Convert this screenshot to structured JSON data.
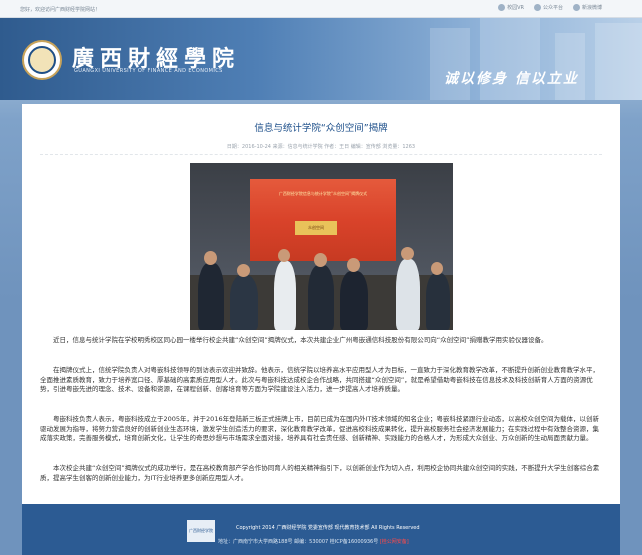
{
  "topbar": {
    "welcome": "您好，欢迎访问广西财经学院网站！",
    "links": [
      {
        "label": "校园VR",
        "icon": "vr-icon"
      },
      {
        "label": "公众平台",
        "icon": "wechat-icon"
      },
      {
        "label": "新浪微博",
        "icon": "weibo-icon"
      }
    ]
  },
  "header": {
    "school_name": "廣西財經學院",
    "school_name_en": "GUANGXI UNIVERSITY OF FINANCE AND ECONOMICS",
    "motto": "诚以修身  信以立业"
  },
  "article": {
    "title": "信息与统计学院“众创空间”揭牌",
    "meta": "日期：2016-10-24    来源：信息与统计学院    作者：王日    编辑：宣传部    浏览量：1263",
    "photo": {
      "banner_text": "广西财经学院信息与统计学院“众创空间”揭牌仪式",
      "plaque_text": "众创空间"
    },
    "paragraphs": [
      "近日，信息与统计学院在学校明秀校区同心园一楼举行校企共建“众创空间”揭牌仪式，本次共建企业广州粤嵌通信科技股份有限公司向“众创空间”捐赠教学用实验仪器设备。",
      "在揭牌仪式上，信统学院负责人对粤嵌科技领导的到访表示欢迎并致辞。他表示，信统学院以培养高水平应用型人才为目标，一直致力于深化教育教学改革，不断提升创新创业教育教学水平，全面推进素质教育，致力于培养宽口径、厚基础的高素质应用型人才。此次与粤嵌科技达成校企合作战略，共同搭建“众创空间”，就是希望借助粤嵌科技在信息技术及科技创新育人方面的资源优势，引进粤嵌先进的理念、技术、设备和资源，在课程创新、创客培育等方面为学院建设注入活力，进一步提高人才培养质量。",
      "粤嵌科技负责人表示，粤嵌科技成立于2005年，并于2016年登陆新三板正式挂牌上市，目前已成为在国内外IT技术领域的知名企业；粤嵌科技紧跟行业动态，以高校众创空间为载体，以创新驱动发展为指导，将努力营造良好的创新创业生态环境，激发学生创造活力的要求，深化教育教学改革，促进高校科技成果转化，提升高校服务社会经济发展能力；在实践过程中有效整合资源，集成落实政策，完善服务模式，培育创新文化，让学生的奇思妙想与市场需求全面对接，培养具有社会责任感、创新精神、实践能力的合格人才，为形成大众创业、万众创新的生动局面贡献力量。",
      "本次校企共建“众创空间”揭牌仪式的成功举行，是在高校教育部产学合作协同育人的相关精神指引下，以创新创业作为切入点，利用校企协同共建众创空间的实践，不断提升大学生创客综合素质，提高学生创客的创新创业能力，为IT行业培养更多创新应用型人才。"
    ]
  },
  "footer": {
    "logo_text": "广西财经学院",
    "copyright": "Copyright 2014 广西财经学院 党委宣传部 现代教育技术部 All Rights Reserved",
    "address": "地址：广西南宁市大学西路188号  邮编：530007  桂ICP备16000936号  ",
    "badge": "[桂公网安备]"
  },
  "colors": {
    "title_blue": "#1d4f8a",
    "footer_blue": "#2c5b93",
    "banner_red": "#d9432a"
  }
}
